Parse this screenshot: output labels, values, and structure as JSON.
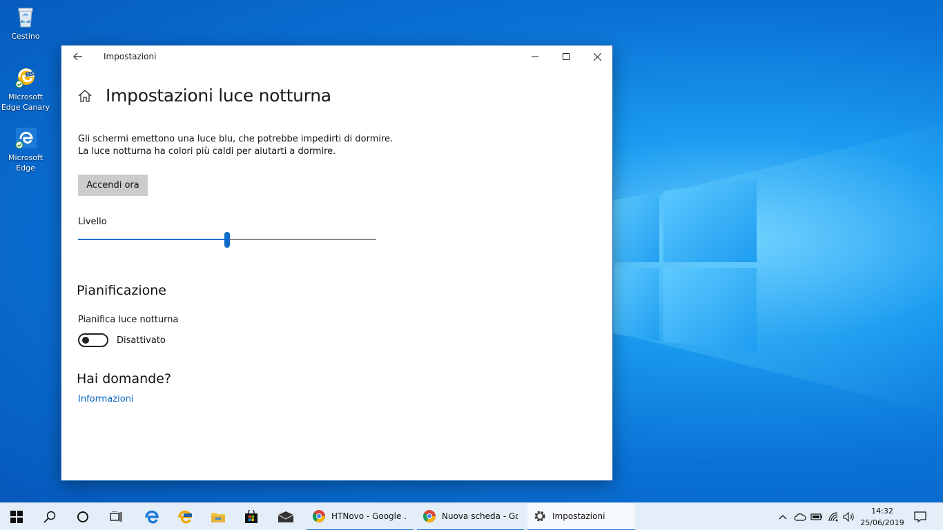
{
  "desktop": {
    "icons": [
      {
        "label": "Cestino",
        "icon": "recycle-bin-icon"
      },
      {
        "label": "Microsoft Edge Canary",
        "icon": "edge-canary-icon"
      },
      {
        "label": "Microsoft Edge",
        "icon": "edge-icon"
      }
    ]
  },
  "window": {
    "title": "Impostazioni",
    "page_title": "Impostazioni luce notturna",
    "description_line1": "Gli schermi emettono una luce blu, che potrebbe impedirti di dormire.",
    "description_line2": "La luce notturna ha colori più caldi per aiutarti a dormire.",
    "turn_on_button": "Accendi ora",
    "level_label": "Livello",
    "level_value": 0.5,
    "schedule_heading": "Pianificazione",
    "schedule_label": "Pianifica luce notturna",
    "schedule_toggle_state": "Disattivato",
    "faq_heading": "Hai domande?",
    "info_link": "Informazioni"
  },
  "taskbar": {
    "apps": [
      {
        "label": "HTNovo - Google ...",
        "icon": "chrome-icon",
        "active": false
      },
      {
        "label": "Nuova scheda - Go...",
        "icon": "chrome-icon",
        "active": false
      },
      {
        "label": "Impostazioni",
        "icon": "gear-icon",
        "active": true
      }
    ],
    "time": "14:32",
    "date": "25/06/2019"
  },
  "colors": {
    "accent": "#0a6cc8",
    "link": "#0a67c2",
    "taskbar": "#e4eef8"
  }
}
